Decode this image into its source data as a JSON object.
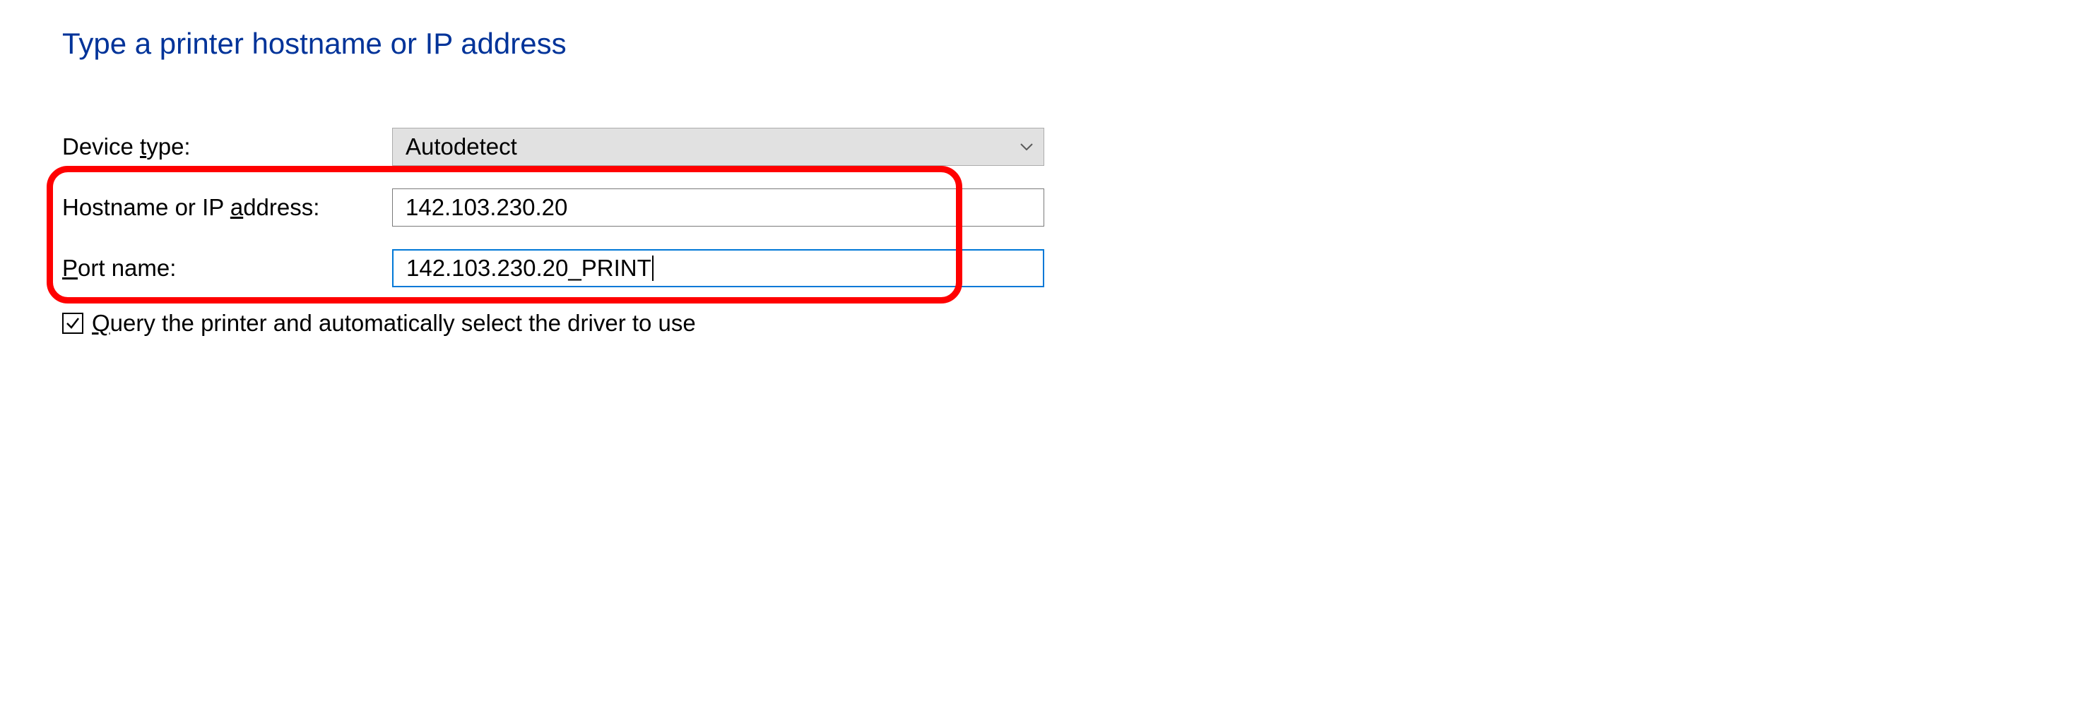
{
  "title": "Type a printer hostname or IP address",
  "fields": {
    "device_type": {
      "label_pre": "Device ",
      "label_u": "t",
      "label_post": "ype:",
      "value": "Autodetect"
    },
    "hostname": {
      "label_pre": "Hostname or IP ",
      "label_u": "a",
      "label_post": "ddress:",
      "value": "142.103.230.20"
    },
    "port": {
      "label_u": "P",
      "label_post": "ort name:",
      "value": "142.103.230.20_PRINT"
    }
  },
  "checkbox": {
    "label_u": "Q",
    "label_post": "uery the printer and automatically select the driver to use",
    "checked": true
  }
}
